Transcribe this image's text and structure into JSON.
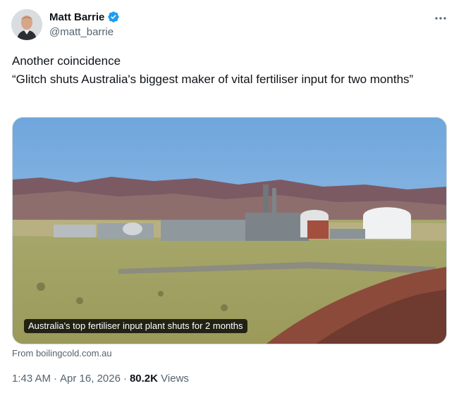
{
  "author": {
    "display_name": "Matt Barrie",
    "handle": "@matt_barrie",
    "verified": true
  },
  "icons": {
    "verified": "verified-badge-icon",
    "more": "more-options-icon"
  },
  "colors": {
    "verified_blue": "#1d9bf0",
    "secondary_text": "#536471",
    "primary_text": "#0f1419"
  },
  "tweet": {
    "line1": "Another coincidence",
    "line2": "“Glitch shuts Australia's biggest maker of vital fertiliser input for two months”"
  },
  "media": {
    "caption": "Australia's top fertiliser input plant shuts for 2 months",
    "source": "From boilingcold.com.au"
  },
  "meta": {
    "time": "1:43 AM",
    "date": "Apr 16, 2026",
    "views_count": "80.2K",
    "views_label": "Views"
  }
}
